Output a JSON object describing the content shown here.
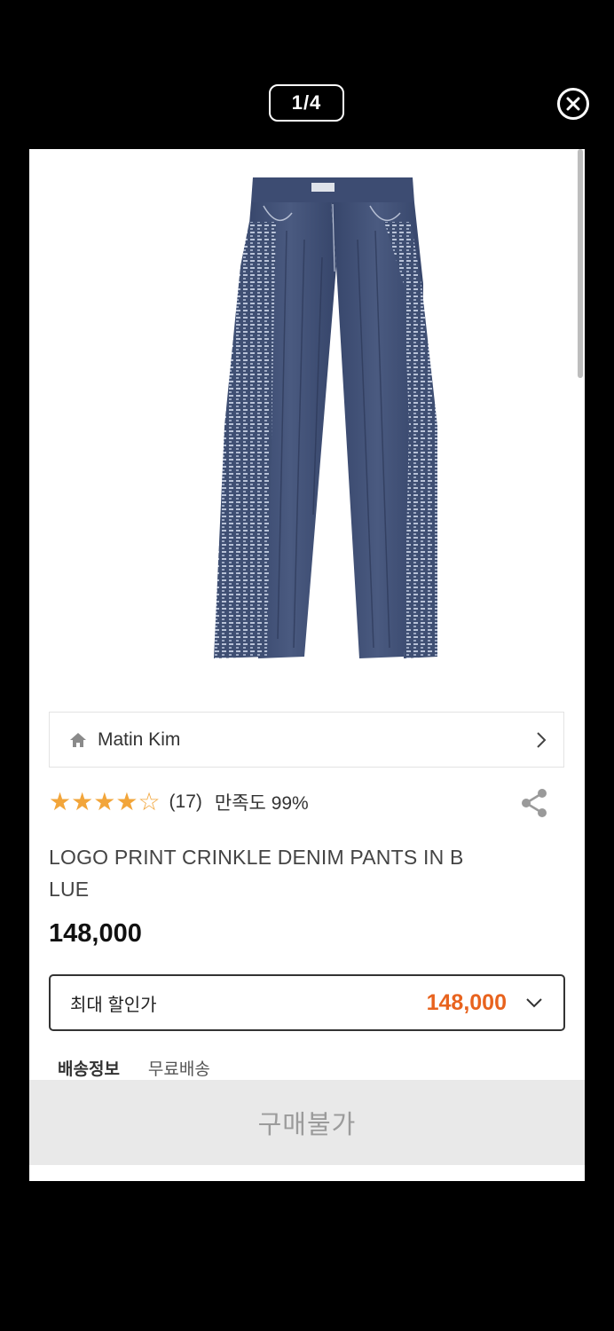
{
  "viewer": {
    "counter": "1/4"
  },
  "product": {
    "brand": "Matin Kim",
    "rating": 4.5,
    "review_count": "(17)",
    "satisfaction": "만족도 99%",
    "title": "LOGO PRINT CRINKLE DENIM PANTS IN B\nLUE",
    "price": "148,000",
    "discount_label": "최대 할인가",
    "discount_price": "148,000",
    "shipping_label": "배송정보",
    "shipping_value": "무료배송",
    "buy_button": "구매불가"
  },
  "colors": {
    "star": "#f2a53a",
    "discount_price": "#e8631e",
    "buy_bar": "#e9e9e9"
  },
  "icons": [
    "close-icon",
    "home-icon",
    "chevron-right-icon",
    "share-icon",
    "chevron-down-icon"
  ]
}
